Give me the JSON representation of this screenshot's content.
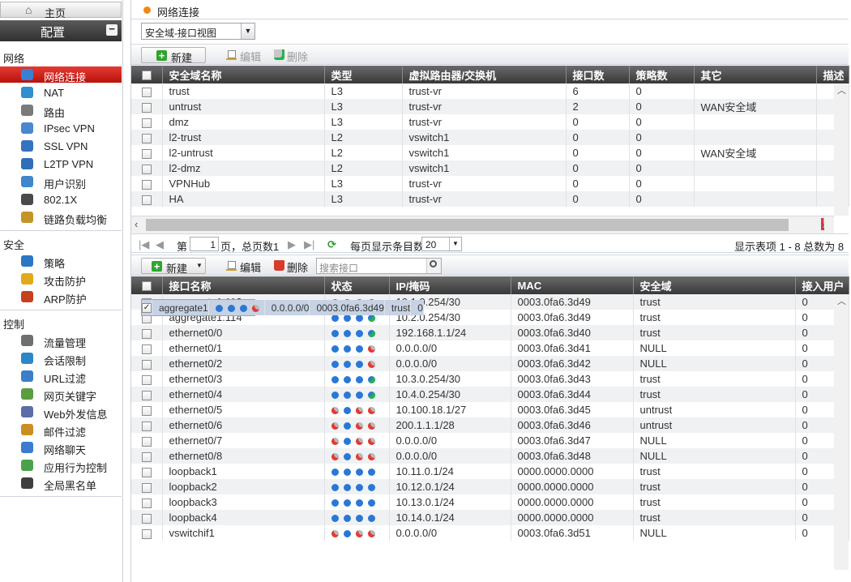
{
  "sidebar": {
    "home": "主页",
    "config": "配置",
    "collapse": "−",
    "sections": [
      {
        "label": "网络",
        "items": [
          "网络连接",
          "NAT",
          "路由",
          "IPsec VPN",
          "SSL VPN",
          "L2TP VPN",
          "用户识别",
          "802.1X",
          "链路负载均衡"
        ]
      },
      {
        "label": "安全",
        "items": [
          "策略",
          "攻击防护",
          "ARP防护"
        ]
      },
      {
        "label": "控制",
        "items": [
          "流量管理",
          "会话限制",
          "URL过滤",
          "网页关键字",
          "Web外发信息",
          "邮件过滤",
          "网络聊天",
          "应用行为控制",
          "全局黑名单"
        ]
      }
    ],
    "icon_colors": [
      "#3a7fd2",
      "#2f8fcf",
      "#7a7a7a",
      "#4a87cf",
      "#3572c0",
      "#2e6fb8",
      "#3f86cb",
      "#4a4a4a",
      "#c49427",
      "#2c77c5",
      "#e3a91c",
      "#c6401f",
      "#6f6f6f",
      "#2c86c7",
      "#3c7ec8",
      "#5a9d3f",
      "#5b6ea8",
      "#cc8d22",
      "#3b7bd0",
      "#4aa34a",
      "#3f3f3f"
    ]
  },
  "title": "网络连接",
  "view_select": "安全域-接口视图",
  "zone_toolbar": {
    "new": "新建",
    "edit": "编辑",
    "delete": "删除"
  },
  "zone_table": {
    "headers": [
      "安全域名称",
      "类型",
      "虚拟路由器/交换机",
      "接口数",
      "策略数",
      "其它",
      "描述"
    ],
    "rows": [
      [
        "trust",
        "L3",
        "trust-vr",
        "6",
        "0",
        ""
      ],
      [
        "untrust",
        "L3",
        "trust-vr",
        "2",
        "0",
        "WAN安全域"
      ],
      [
        "dmz",
        "L3",
        "trust-vr",
        "0",
        "0",
        ""
      ],
      [
        "l2-trust",
        "L2",
        "vswitch1",
        "0",
        "0",
        ""
      ],
      [
        "l2-untrust",
        "L2",
        "vswitch1",
        "0",
        "0",
        "WAN安全域"
      ],
      [
        "l2-dmz",
        "L2",
        "vswitch1",
        "0",
        "0",
        ""
      ],
      [
        "VPNHub",
        "L3",
        "trust-vr",
        "0",
        "0",
        ""
      ],
      [
        "HA",
        "L3",
        "trust-vr",
        "0",
        "0",
        ""
      ]
    ]
  },
  "pager": {
    "page_prefix": "第",
    "page": "1",
    "page_suffix": "页，总页数1",
    "per_page_label": "每页显示条目数",
    "per_page": "20",
    "summary": "显示表项 1 - 8 总数为 8"
  },
  "if_toolbar": {
    "new": "新建",
    "edit": "编辑",
    "delete": "删除",
    "search_placeholder": "搜索接口"
  },
  "if_table": {
    "headers": [
      "接口名称",
      "状态",
      "IP/掩码",
      "MAC",
      "安全域",
      "接入用户"
    ],
    "rows": [
      {
        "name": "aggregate1",
        "status": "bbbr",
        "ip": "0.0.0.0/0",
        "mac": "0003.0fa6.3d49",
        "zone": "trust",
        "users": "0",
        "checked": true
      },
      {
        "name": "aggregate1.113",
        "status": "bbbg",
        "ip": "10.1.0.254/30",
        "mac": "0003.0fa6.3d49",
        "zone": "trust",
        "users": "0"
      },
      {
        "name": "aggregate1.114",
        "status": "bbbg",
        "ip": "10.2.0.254/30",
        "mac": "0003.0fa6.3d49",
        "zone": "trust",
        "users": "0"
      },
      {
        "name": "ethernet0/0",
        "status": "bbbg",
        "ip": "192.168.1.1/24",
        "mac": "0003.0fa6.3d40",
        "zone": "trust",
        "users": "0"
      },
      {
        "name": "ethernet0/1",
        "status": "bbbr",
        "ip": "0.0.0.0/0",
        "mac": "0003.0fa6.3d41",
        "zone": "NULL",
        "users": "0"
      },
      {
        "name": "ethernet0/2",
        "status": "bbbr",
        "ip": "0.0.0.0/0",
        "mac": "0003.0fa6.3d42",
        "zone": "NULL",
        "users": "0"
      },
      {
        "name": "ethernet0/3",
        "status": "bbbg",
        "ip": "10.3.0.254/30",
        "mac": "0003.0fa6.3d43",
        "zone": "trust",
        "users": "0"
      },
      {
        "name": "ethernet0/4",
        "status": "bbbg",
        "ip": "10.4.0.254/30",
        "mac": "0003.0fa6.3d44",
        "zone": "trust",
        "users": "0"
      },
      {
        "name": "ethernet0/5",
        "status": "rbrr",
        "ip": "10.100.18.1/27",
        "mac": "0003.0fa6.3d45",
        "zone": "untrust",
        "users": "0"
      },
      {
        "name": "ethernet0/6",
        "status": "rbrr",
        "ip": "200.1.1.1/28",
        "mac": "0003.0fa6.3d46",
        "zone": "untrust",
        "users": "0"
      },
      {
        "name": "ethernet0/7",
        "status": "rbrr",
        "ip": "0.0.0.0/0",
        "mac": "0003.0fa6.3d47",
        "zone": "NULL",
        "users": "0"
      },
      {
        "name": "ethernet0/8",
        "status": "rbrr",
        "ip": "0.0.0.0/0",
        "mac": "0003.0fa6.3d48",
        "zone": "NULL",
        "users": "0"
      },
      {
        "name": "loopback1",
        "status": "bbbb",
        "ip": "10.11.0.1/24",
        "mac": "0000.0000.0000",
        "zone": "trust",
        "users": "0"
      },
      {
        "name": "loopback2",
        "status": "bbbb",
        "ip": "10.12.0.1/24",
        "mac": "0000.0000.0000",
        "zone": "trust",
        "users": "0"
      },
      {
        "name": "loopback3",
        "status": "bbbb",
        "ip": "10.13.0.1/24",
        "mac": "0000.0000.0000",
        "zone": "trust",
        "users": "0"
      },
      {
        "name": "loopback4",
        "status": "bbbb",
        "ip": "10.14.0.1/24",
        "mac": "0000.0000.0000",
        "zone": "trust",
        "users": "0"
      },
      {
        "name": "vswitchif1",
        "status": "rbrr",
        "ip": "0.0.0.0/0",
        "mac": "0003.0fa6.3d51",
        "zone": "NULL",
        "users": "0"
      }
    ]
  }
}
